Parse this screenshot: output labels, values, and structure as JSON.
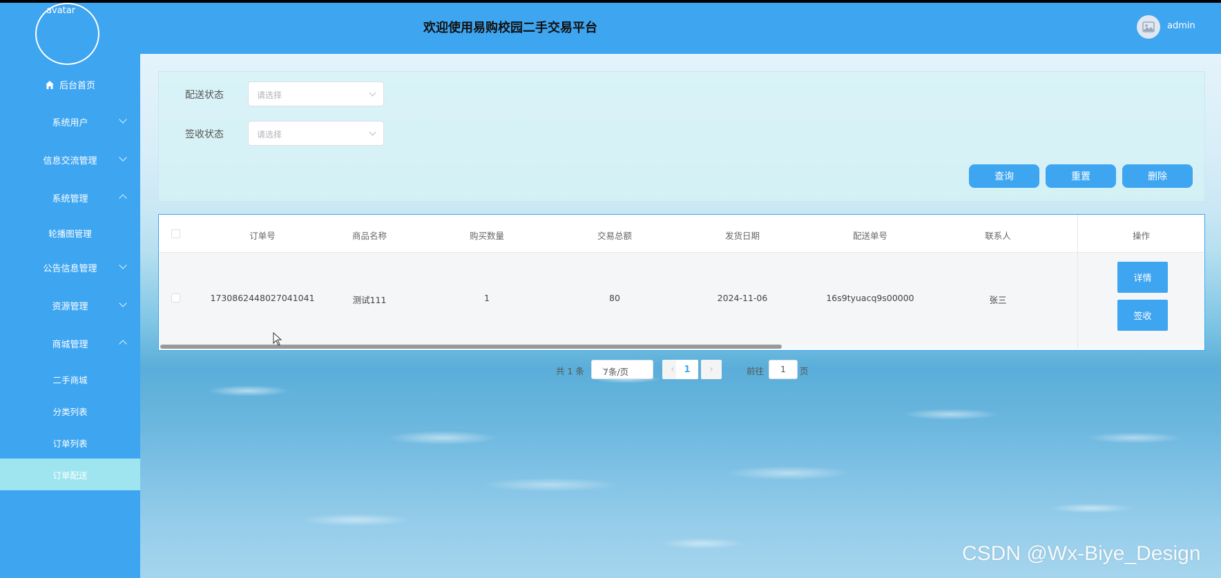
{
  "sidebar": {
    "avatar_label": "avatar",
    "items": [
      {
        "label": "后台首页"
      },
      {
        "label": "系统用户"
      },
      {
        "label": "信息交流管理"
      },
      {
        "label": "系统管理"
      },
      {
        "label": "轮播图管理"
      },
      {
        "label": "公告信息管理"
      },
      {
        "label": "资源管理"
      },
      {
        "label": "商城管理"
      },
      {
        "label": "二手商城"
      },
      {
        "label": "分类列表"
      },
      {
        "label": "订单列表"
      },
      {
        "label": "订单配送"
      }
    ]
  },
  "header": {
    "title": "欢迎使用易购校园二手交易平台",
    "username": "admin"
  },
  "search": {
    "delivery_status_label": "配送状态",
    "sign_status_label": "签收状态",
    "placeholder": "请选择",
    "query_button": "查询",
    "reset_button": "重置",
    "delete_button": "删除"
  },
  "table": {
    "headers": [
      "订单号",
      "商品名称",
      "购买数量",
      "交易总额",
      "发货日期",
      "配送单号",
      "联系人",
      "操作"
    ],
    "rows": [
      {
        "order_no": "1730862448027041041",
        "product": "测试111",
        "quantity": "1",
        "total": "80",
        "ship_date": "2024-11-06",
        "delivery_no": "16s9tyuacq9s00000",
        "contact": "张三",
        "detail_button": "详情",
        "sign_button": "签收"
      }
    ]
  },
  "pagination": {
    "total": "共 1 条",
    "page_size": "7条/页",
    "current_page": "1",
    "prev": "‹",
    "next": "›",
    "goto_label": "前往",
    "goto_value": "1",
    "page_suffix": "页"
  },
  "watermark": "CSDN @Wx-Biye_Design",
  "colors": {
    "primary": "#3ea5f1",
    "active_menu": "#9ee5ef"
  }
}
